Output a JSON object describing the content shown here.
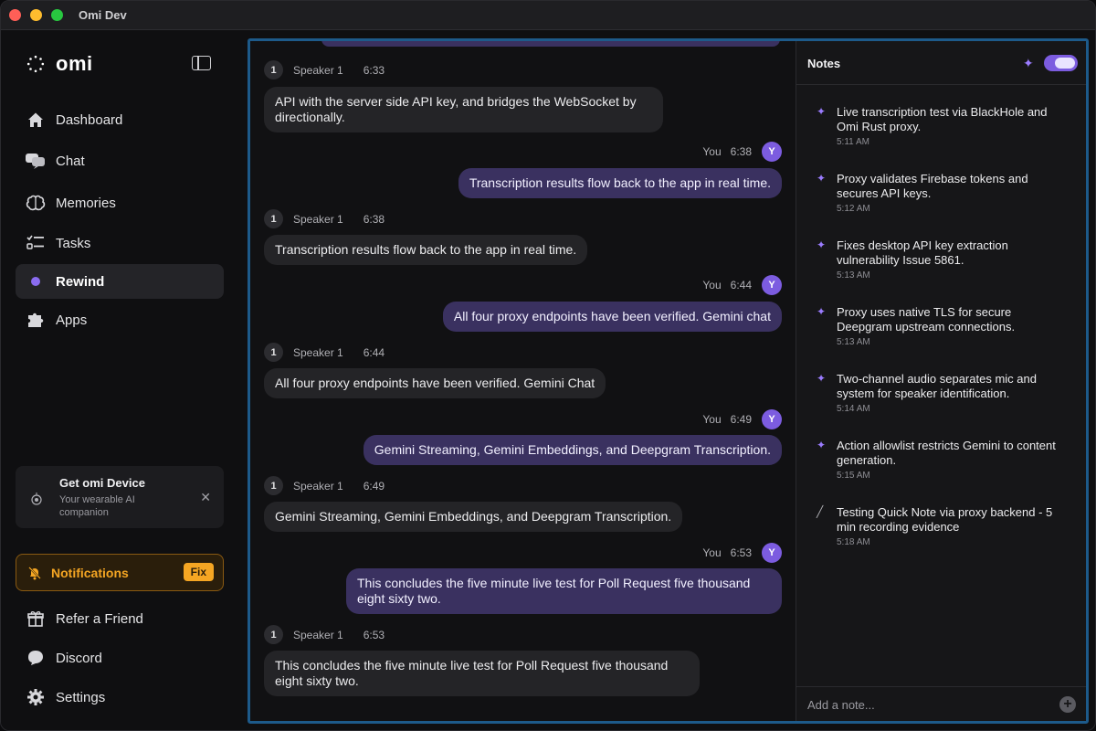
{
  "window": {
    "title": "Omi Dev"
  },
  "sidebar": {
    "logo": "omi",
    "nav": [
      {
        "label": "Dashboard",
        "icon": "home-icon"
      },
      {
        "label": "Chat",
        "icon": "chat-icon"
      },
      {
        "label": "Memories",
        "icon": "brain-icon"
      },
      {
        "label": "Tasks",
        "icon": "tasks-icon"
      },
      {
        "label": "Rewind",
        "icon": "record-dot-icon",
        "active": true
      },
      {
        "label": "Apps",
        "icon": "puzzle-icon"
      }
    ],
    "device_card": {
      "title": "Get omi Device",
      "subtitle": "Your wearable AI companion"
    },
    "notifications": {
      "label": "Notifications",
      "fix": "Fix"
    },
    "bottom": [
      {
        "label": "Refer a Friend",
        "icon": "gift-icon"
      },
      {
        "label": "Discord",
        "icon": "discord-icon"
      },
      {
        "label": "Settings",
        "icon": "gear-icon"
      }
    ]
  },
  "transcript": {
    "messages": [
      {
        "who": "speaker",
        "num": "1",
        "name": "Speaker 1",
        "time": "6:33",
        "text": "API with the server side API key, and bridges the WebSocket by directionally."
      },
      {
        "who": "you",
        "name": "You",
        "time": "6:38",
        "avatar": "Y",
        "text": "Transcription results flow back to the app in real time."
      },
      {
        "who": "speaker",
        "num": "1",
        "name": "Speaker 1",
        "time": "6:38",
        "text": "Transcription results flow back to the app in real time."
      },
      {
        "who": "you",
        "name": "You",
        "time": "6:44",
        "avatar": "Y",
        "text": "All four proxy endpoints have been verified. Gemini chat"
      },
      {
        "who": "speaker",
        "num": "1",
        "name": "Speaker 1",
        "time": "6:44",
        "text": "All four proxy endpoints have been verified. Gemini Chat"
      },
      {
        "who": "you",
        "name": "You",
        "time": "6:49",
        "avatar": "Y",
        "text": "Gemini Streaming, Gemini Embeddings, and Deepgram Transcription."
      },
      {
        "who": "speaker",
        "num": "1",
        "name": "Speaker 1",
        "time": "6:49",
        "text": "Gemini Streaming, Gemini Embeddings, and Deepgram Transcription."
      },
      {
        "who": "you",
        "name": "You",
        "time": "6:53",
        "avatar": "Y",
        "text": "This concludes the five minute live test for Poll Request five thousand eight sixty two."
      },
      {
        "who": "speaker",
        "num": "1",
        "name": "Speaker 1",
        "time": "6:53",
        "text": "This concludes the five minute live test for Poll Request five thousand eight sixty two."
      }
    ]
  },
  "notes": {
    "title": "Notes",
    "items": [
      {
        "text": "Live transcription test via BlackHole and Omi Rust proxy.",
        "time": "5:11 AM",
        "kind": "ai"
      },
      {
        "text": "Proxy validates Firebase tokens and secures API keys.",
        "time": "5:12 AM",
        "kind": "ai"
      },
      {
        "text": "Fixes desktop API key extraction vulnerability Issue 5861.",
        "time": "5:13 AM",
        "kind": "ai"
      },
      {
        "text": "Proxy uses native TLS for secure Deepgram upstream connections.",
        "time": "5:13 AM",
        "kind": "ai"
      },
      {
        "text": "Two-channel audio separates mic and system for speaker identification.",
        "time": "5:14 AM",
        "kind": "ai"
      },
      {
        "text": "Action allowlist restricts Gemini to content generation.",
        "time": "5:15 AM",
        "kind": "ai"
      },
      {
        "text": "Testing Quick Note via proxy backend - 5 min recording evidence",
        "time": "5:18 AM",
        "kind": "manual"
      }
    ],
    "add_placeholder": "Add a note...",
    "add_button": "+"
  }
}
